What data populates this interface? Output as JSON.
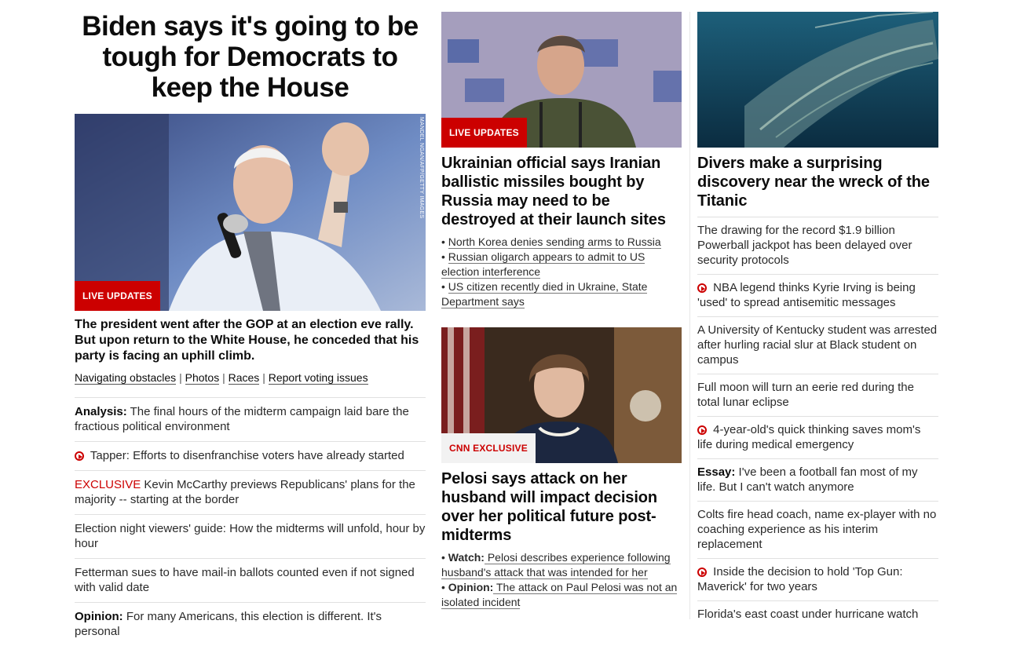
{
  "col1": {
    "headline": "Biden says it's going to be tough for Democrats to keep the House",
    "image_credit": "MANDEL NGAN/AFP/GETTY IMAGES",
    "badge": "LIVE UPDATES",
    "lede": "The president went after the GOP at an election eve rally. But upon return to the White House, he conceded that his party is facing an uphill climb.",
    "links": [
      "Navigating obstacles",
      "Photos",
      "Races",
      "Report voting issues"
    ],
    "link_separator": "|",
    "list": [
      {
        "prefix": "Analysis:",
        "text": " The final hours of the midterm campaign laid bare the fractious political environment"
      },
      {
        "icon": "play-icon",
        "text": "Tapper: Efforts to disenfranchise voters have already started"
      },
      {
        "tag": "EXCLUSIVE",
        "text": " Kevin McCarthy previews Republicans' plans for the majority -- starting at the border"
      },
      {
        "text": "Election night viewers' guide: How the midterms will unfold, hour by hour"
      },
      {
        "text": "Fetterman sues to have mail-in ballots counted even if not signed with valid date"
      },
      {
        "prefix": "Opinion:",
        "text": " For many Americans, this election is different. It's personal"
      }
    ]
  },
  "col2": {
    "story1": {
      "badge": "LIVE UPDATES",
      "headline": "Ukrainian official says Iranian ballistic missiles bought by Russia may need to be destroyed at their launch sites",
      "bullets": [
        "North Korea denies sending arms to Russia",
        "Russian oligarch appears to admit to US election interference",
        "US citizen recently died in Ukraine, State Department says"
      ]
    },
    "story2": {
      "badge": "CNN EXCLUSIVE",
      "headline": "Pelosi says attack on her husband will impact decision over her political future post-midterms",
      "bullets": [
        {
          "prefix": "Watch:",
          "text": " Pelosi describes experience following husband's attack that was intended for her"
        },
        {
          "prefix": "Opinion:",
          "text": " The attack on Paul Pelosi was not an isolated incident"
        }
      ]
    },
    "bullet_char": "•"
  },
  "col3": {
    "headline": "Divers make a surprising discovery near the wreck of the Titanic",
    "list": [
      {
        "text": "The drawing for the record $1.9 billion Powerball jackpot has been delayed over security protocols"
      },
      {
        "icon": "play-icon",
        "text": "NBA legend thinks Kyrie Irving is being 'used' to spread antisemitic messages"
      },
      {
        "text": "A University of Kentucky student was arrested after hurling racial slur at Black student on campus"
      },
      {
        "text": "Full moon will turn an eerie red during the total lunar eclipse"
      },
      {
        "icon": "play-icon",
        "text": "4-year-old's quick thinking saves mom's life during medical emergency"
      },
      {
        "prefix": "Essay:",
        "text": " I've been a football fan most of my life. But I can't watch anymore"
      },
      {
        "text": "Colts fire head coach, name ex-player with no coaching experience as his interim replacement"
      },
      {
        "icon": "play-icon",
        "text": "Inside the decision to hold 'Top Gun: Maverick' for two years"
      },
      {
        "text": "Florida's east coast under hurricane watch"
      }
    ]
  },
  "colors": {
    "accent": "#cc0000",
    "text": "#0c0c0c",
    "divider": "#e0e0e0"
  }
}
